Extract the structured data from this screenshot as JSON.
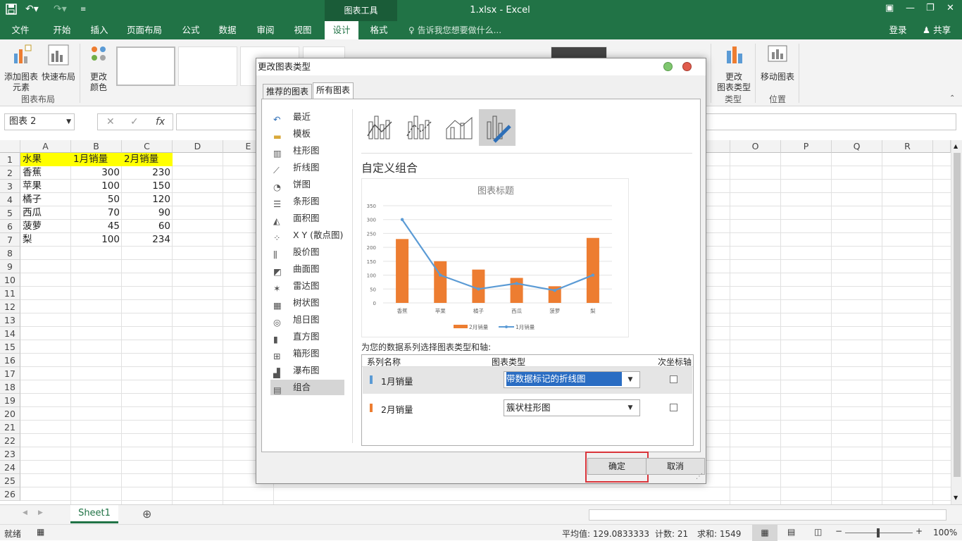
{
  "window": {
    "title": "1.xlsx - Excel",
    "chart_tools": "图表工具",
    "login": "登录",
    "share": "共享"
  },
  "tabs": [
    "文件",
    "开始",
    "插入",
    "页面布局",
    "公式",
    "数据",
    "审阅",
    "视图",
    "设计",
    "格式"
  ],
  "active_tab": "设计",
  "tellme": "告诉我您想要做什么...",
  "ribbon": {
    "add_element": "添加图表\n元素",
    "add_element_l1": "添加图表",
    "add_element_l2": "元素",
    "quick_layout": "快速布局",
    "change_color_l1": "更改",
    "change_color_l2": "颜色",
    "group_layout": "图表布局",
    "change_type_l1": "更改",
    "change_type_l2": "图表类型",
    "move_chart": "移动图表",
    "group_type": "类型",
    "group_location": "位置"
  },
  "namebox": "图表 2",
  "columns": [
    "A",
    "B",
    "C",
    "D",
    "E",
    "O",
    "P",
    "Q",
    "R"
  ],
  "rows": [
    "1",
    "2",
    "3",
    "4",
    "5",
    "6",
    "7",
    "8",
    "9",
    "10",
    "11",
    "12",
    "13",
    "14",
    "15",
    "16",
    "17",
    "18",
    "19",
    "20",
    "21",
    "22",
    "23",
    "24",
    "25",
    "26"
  ],
  "cells": {
    "header": [
      "水果",
      "1月销量",
      "2月销量"
    ],
    "data": [
      [
        "香蕉",
        "300",
        "230"
      ],
      [
        "苹果",
        "100",
        "150"
      ],
      [
        "橘子",
        "50",
        "120"
      ],
      [
        "西瓜",
        "70",
        "90"
      ],
      [
        "菠萝",
        "45",
        "60"
      ],
      [
        "梨",
        "100",
        "234"
      ]
    ]
  },
  "sheet_tab": "Sheet1",
  "status": {
    "ready": "就绪",
    "average": "平均值: 129.0833333",
    "count": "计数: 21",
    "sum": "求和: 1549",
    "zoom": "100%"
  },
  "dialog": {
    "title": "更改图表类型",
    "tab_recommended": "推荐的图表",
    "tab_all": "所有图表",
    "nav": [
      "最近",
      "模板",
      "柱形图",
      "折线图",
      "饼图",
      "条形图",
      "面积图",
      "X Y (散点图)",
      "股价图",
      "曲面图",
      "雷达图",
      "树状图",
      "旭日图",
      "直方图",
      "箱形图",
      "瀑布图",
      "组合"
    ],
    "nav_selected": "组合",
    "section_title": "自定义组合",
    "series_prompt": "为您的数据系列选择图表类型和轴:",
    "col_series": "系列名称",
    "col_type": "图表类型",
    "col_secondary": "次坐标轴",
    "series": [
      {
        "name": "1月销量",
        "type": "带数据标记的折线图",
        "color": "#5b9bd5"
      },
      {
        "name": "2月销量",
        "type": "簇状柱形图",
        "color": "#ed7d31"
      }
    ],
    "ok": "确定",
    "cancel": "取消"
  },
  "chart_data": {
    "type": "bar",
    "title": "图表标题",
    "categories": [
      "香蕉",
      "苹果",
      "橘子",
      "西瓜",
      "菠萝",
      "梨"
    ],
    "series": [
      {
        "name": "2月销量",
        "kind": "bar",
        "color": "#ed7d31",
        "values": [
          230,
          150,
          120,
          90,
          60,
          234
        ]
      },
      {
        "name": "1月销量",
        "kind": "line",
        "color": "#5b9bd5",
        "values": [
          300,
          100,
          50,
          70,
          45,
          100
        ]
      }
    ],
    "ylim": [
      0,
      350
    ],
    "yticks": [
      "0",
      "50",
      "100",
      "150",
      "200",
      "250",
      "300",
      "350"
    ],
    "legend": "bottom",
    "grid": true
  },
  "colors": {
    "excel_green": "#217346",
    "header_fill": "#ffff00",
    "highlight_box": "#d9343a",
    "selected_combo": "#2a6dc3"
  }
}
